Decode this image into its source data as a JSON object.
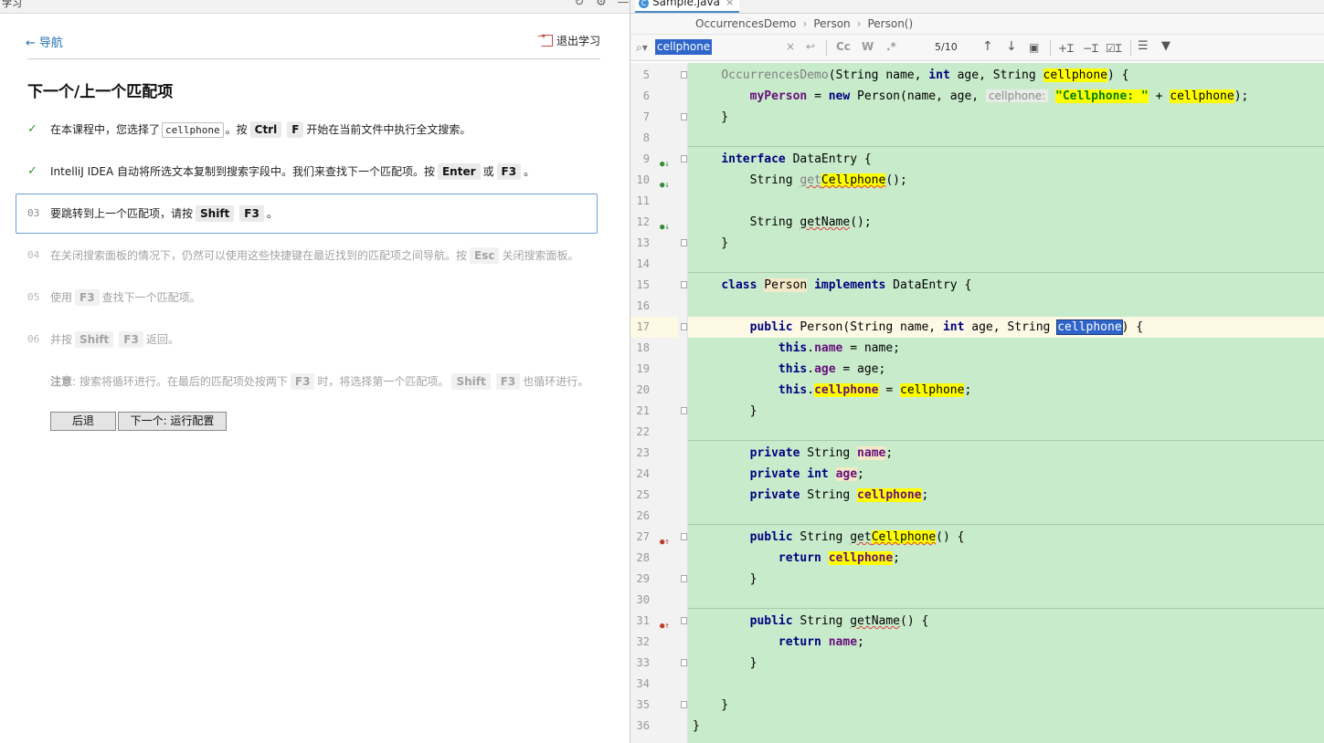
{
  "learn": {
    "panel_title": "学习",
    "nav_back": "导航",
    "exit": "退出学习",
    "lesson_title": "下一个/上一个匹配项",
    "steps": [
      {
        "marker": "✓",
        "parts": [
          "在本课程中，您选择了",
          "cellphone",
          "。按",
          "Ctrl",
          "F",
          "开始在当前文件中执行全文搜索。"
        ]
      },
      {
        "marker": "✓",
        "parts": [
          "IntelliJ IDEA 自动将所选文本复制到搜索字段中。我们来查找下一个匹配项。按",
          "Enter",
          "或",
          "F3",
          "。"
        ]
      },
      {
        "marker": "03",
        "parts": [
          "要跳转到上一个匹配项，请按",
          "Shift",
          "F3",
          "。"
        ]
      },
      {
        "marker": "04",
        "parts": [
          "在关闭搜索面板的情况下，仍然可以使用这些快捷键在最近找到的匹配项之间导航。按",
          "Esc",
          "关闭搜索面板。"
        ]
      },
      {
        "marker": "05",
        "parts": [
          "使用",
          "F3",
          "查找下一个匹配项。"
        ]
      },
      {
        "marker": "06",
        "parts": [
          "并按",
          "Shift",
          "F3",
          "返回。"
        ]
      }
    ],
    "note": {
      "label": "注意",
      "parts": [
        ": 搜索将循环进行。在最后的匹配项处按两下",
        "F3",
        "时，将选择第一个匹配项。",
        "Shift",
        "F3",
        "也循环进行。"
      ]
    },
    "btn_back": "后退",
    "btn_next": "下一个: 运行配置"
  },
  "editor": {
    "tab": "Sample.java",
    "breadcrumb": [
      "OccurrencesDemo",
      "Person",
      "Person()"
    ],
    "search": {
      "value": "cellphone",
      "match_count": "5/10",
      "case_btn": "Cc",
      "word_btn": "W",
      "regex_btn": ".*"
    },
    "line_numbers": [
      "5",
      "6",
      "7",
      "8",
      "9",
      "10",
      "11",
      "12",
      "13",
      "14",
      "15",
      "16",
      "17",
      "18",
      "19",
      "20",
      "21",
      "22",
      "23",
      "24",
      "25",
      "26",
      "27",
      "28",
      "29",
      "30",
      "31",
      "32",
      "33",
      "34",
      "35",
      "36"
    ],
    "param_hint": "cellphone:"
  }
}
